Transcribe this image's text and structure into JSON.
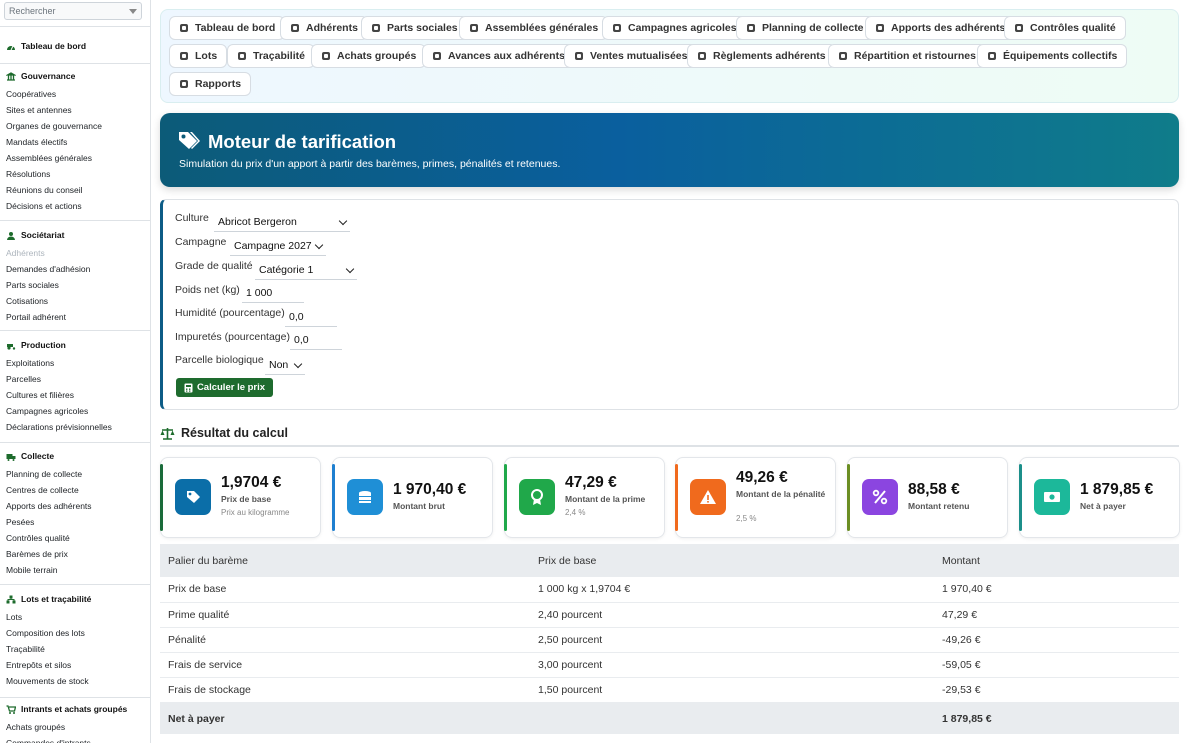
{
  "sidebar": {
    "search_placeholder": "Rechercher",
    "dashboard": "Tableau de bord",
    "sections": [
      {
        "title": "Gouvernance",
        "items": [
          "Coopératives",
          "Sites et antennes",
          "Organes de gouvernance",
          "Mandats électifs",
          "Assemblées générales",
          "Résolutions",
          "Réunions du conseil",
          "Décisions et actions"
        ]
      },
      {
        "title": "Sociétariat",
        "items": [
          "Adhérents",
          "Demandes d'adhésion",
          "Parts sociales",
          "Cotisations",
          "Portail adhérent"
        ]
      },
      {
        "title": "Production",
        "items": [
          "Exploitations",
          "Parcelles",
          "Cultures et filières",
          "Campagnes agricoles",
          "Déclarations prévisionnelles"
        ]
      },
      {
        "title": "Collecte",
        "items": [
          "Planning de collecte",
          "Centres de collecte",
          "Apports des adhérents",
          "Pesées",
          "Contrôles qualité",
          "Barèmes de prix",
          "Mobile terrain"
        ]
      },
      {
        "title": "Lots et traçabilité",
        "items": [
          "Lots",
          "Composition des lots",
          "Traçabilité",
          "Entrepôts et silos",
          "Mouvements de stock"
        ]
      },
      {
        "title": "Intrants et achats groupés",
        "items": [
          "Achats groupés",
          "Commandes d'intrants"
        ]
      }
    ]
  },
  "topnav": {
    "items": [
      "Tableau de bord",
      "Adhérents",
      "Parts sociales",
      "Assemblées générales",
      "Campagnes agricoles",
      "Planning de collecte",
      "Apports des adhérents",
      "Contrôles qualité",
      "Lots",
      "Traçabilité",
      "Achats groupés",
      "Avances aux adhérents",
      "Ventes mutualisées",
      "Règlements adhérents",
      "Répartition et ristournes",
      "Équipements collectifs",
      "Rapports"
    ]
  },
  "hero": {
    "title": "Moteur de tarification",
    "subtitle": "Simulation du prix d'un apport à partir des barèmes, primes, pénalités et retenues."
  },
  "form": {
    "culture_label": "Culture",
    "culture_value": "Abricot Bergeron",
    "campagne_label": "Campagne",
    "campagne_value": "Campagne 2027",
    "grade_label": "Grade de qualité",
    "grade_value": "Catégorie 1",
    "poids_label": "Poids net (kg)",
    "poids_value": "1 000",
    "humidite_label": "Humidité (pourcentage)",
    "humidite_value": "0,0",
    "impuretes_label": "Impuretés (pourcentage)",
    "impuretes_value": "0,0",
    "bio_label": "Parcelle biologique",
    "bio_value": "Non",
    "submit_label": "Calculer le prix"
  },
  "result": {
    "title": "Résultat du calcul",
    "kpis": [
      {
        "value": "1,9704 €",
        "label": "Prix de base",
        "sub": "Prix au kilogramme",
        "color": "#0b6ea8",
        "accent": "#1a6b3a"
      },
      {
        "value": "1 970,40 €",
        "label": "Montant brut",
        "sub": "",
        "color": "#1f8fd6",
        "accent": "#1e7fd0"
      },
      {
        "value": "47,29 €",
        "label": "Montant de la prime",
        "sub": "2,4 %",
        "color": "#20a84a",
        "accent": "#20a84a"
      },
      {
        "value": "49,26 €",
        "label": "Montant de la pénalité",
        "sub": "2,5 %",
        "color": "#f06a1d",
        "accent": "#f06a1d"
      },
      {
        "value": "88,58 €",
        "label": "Montant retenu",
        "sub": "",
        "color": "#8b45e0",
        "accent": "#6b8e23"
      },
      {
        "value": "1 879,85 €",
        "label": "Net à payer",
        "sub": "",
        "color": "#1cb89a",
        "accent": "#1c8f8a"
      }
    ],
    "table": {
      "headers": [
        "Palier du barème",
        "Prix de base",
        "Montant"
      ],
      "rows": [
        [
          "Prix de base",
          "1 000 kg x 1,9704 €",
          "1 970,40 €"
        ],
        [
          "Prime qualité",
          "2,40 pourcent",
          "47,29 €"
        ],
        [
          "Pénalité",
          "2,50 pourcent",
          "-49,26 €"
        ],
        [
          "Frais de service",
          "3,00 pourcent",
          "-59,05 €"
        ],
        [
          "Frais de stockage",
          "1,50 pourcent",
          "-29,53 €"
        ]
      ],
      "total_label": "Net à payer",
      "total_value": "1 879,85 €"
    }
  }
}
